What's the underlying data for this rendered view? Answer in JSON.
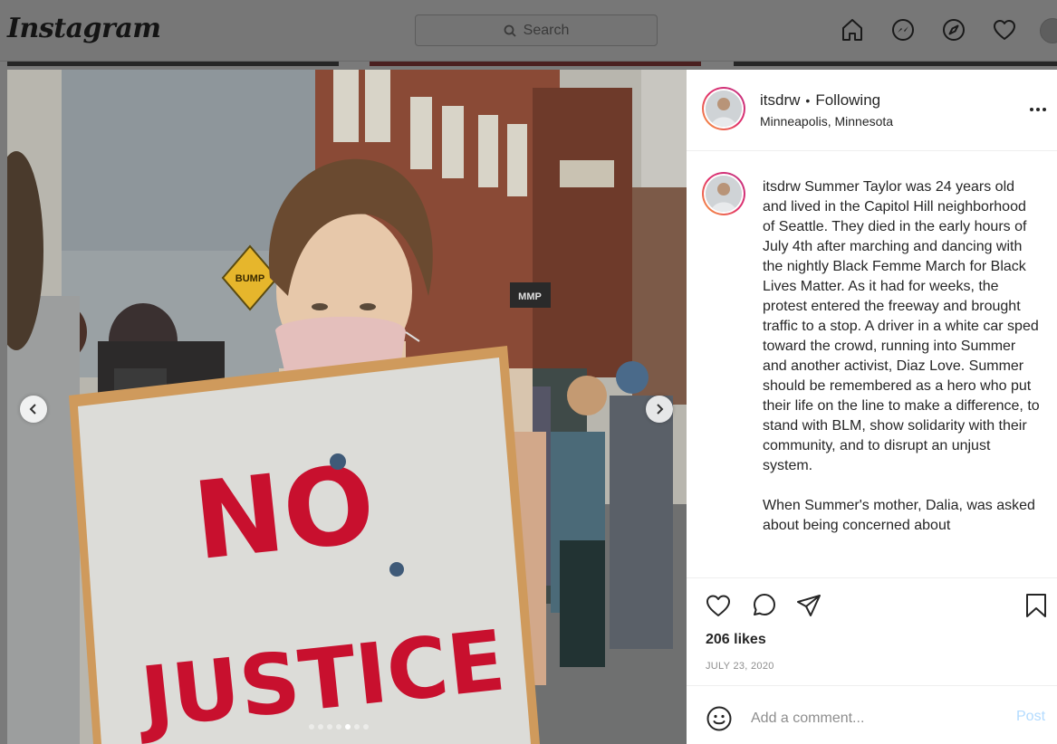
{
  "topbar": {
    "logo": "Instagram",
    "search_placeholder": "Search"
  },
  "photo": {
    "sign_line1": "NO",
    "sign_line2": "JUSTICE",
    "street_sign": "BUMP",
    "shop_sign": "MMP",
    "carousel": {
      "total": 7,
      "active_index": 4
    }
  },
  "post": {
    "username": "itsdrw",
    "separator": "•",
    "follow_status": "Following",
    "location": "Minneapolis, Minnesota",
    "caption_p1": "Summer Taylor was 24 years old and lived in the Capitol Hill neighborhood of Seattle. They died in the early hours of July 4th after marching and dancing with the nightly Black Femme March for Black Lives Matter. As it had for weeks, the protest entered the freeway and brought traffic to a stop. A driver in a white car sped toward the crowd, running into Summer and another activist, Diaz Love. Summer should be remembered as a hero who put their life on the line to make a difference, to stand with BLM, show solidarity with their community, and to disrupt an unjust system.",
    "caption_p2": "When Summer's mother, Dalia, was asked about being concerned about",
    "likes": "206 likes",
    "date": "JULY 23, 2020",
    "comment_placeholder": "Add a comment...",
    "post_label": "Post"
  },
  "colors": {
    "post_button_disabled": "#b3dbff",
    "story_ring": [
      "#f9a13a",
      "#e1306c",
      "#c13584"
    ],
    "sign_paint": "#c8102e"
  }
}
